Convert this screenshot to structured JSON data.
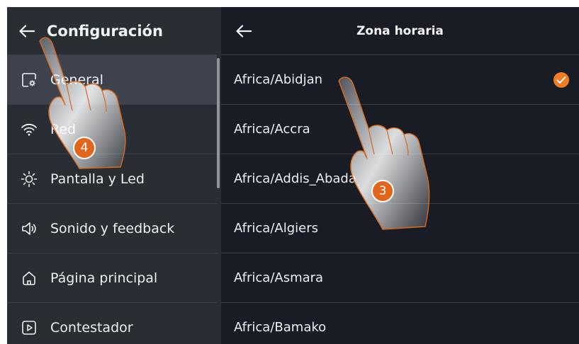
{
  "settings": {
    "title": "Configuración",
    "items": [
      {
        "label": "General",
        "icon": "general-settings-icon",
        "selected": true
      },
      {
        "label": "Red",
        "icon": "wifi-icon",
        "selected": false
      },
      {
        "label": "Pantalla y Led",
        "icon": "brightness-icon",
        "selected": false
      },
      {
        "label": "Sonido y feedback",
        "icon": "speaker-icon",
        "selected": false
      },
      {
        "label": "Página principal",
        "icon": "home-icon",
        "selected": false
      },
      {
        "label": "Contestador",
        "icon": "play-icon",
        "selected": false
      }
    ]
  },
  "timezone": {
    "title": "Zona horaria",
    "items": [
      {
        "label": "Africa/Abidjan",
        "checked": true
      },
      {
        "label": "Africa/Accra",
        "checked": false
      },
      {
        "label": "Africa/Addis_Abada",
        "checked": false
      },
      {
        "label": "Africa/Algiers",
        "checked": false
      },
      {
        "label": "Africa/Asmara",
        "checked": false
      },
      {
        "label": "Africa/Bamako",
        "checked": false
      }
    ]
  },
  "annotations": [
    {
      "number": "4",
      "icon": "pointing-hand-icon"
    },
    {
      "number": "3",
      "icon": "pointing-hand-icon"
    }
  ],
  "colors": {
    "accent": "#f07c24",
    "sidebar_bg": "#292d34",
    "main_bg": "#191c24",
    "selected_bg": "#3d424c"
  }
}
